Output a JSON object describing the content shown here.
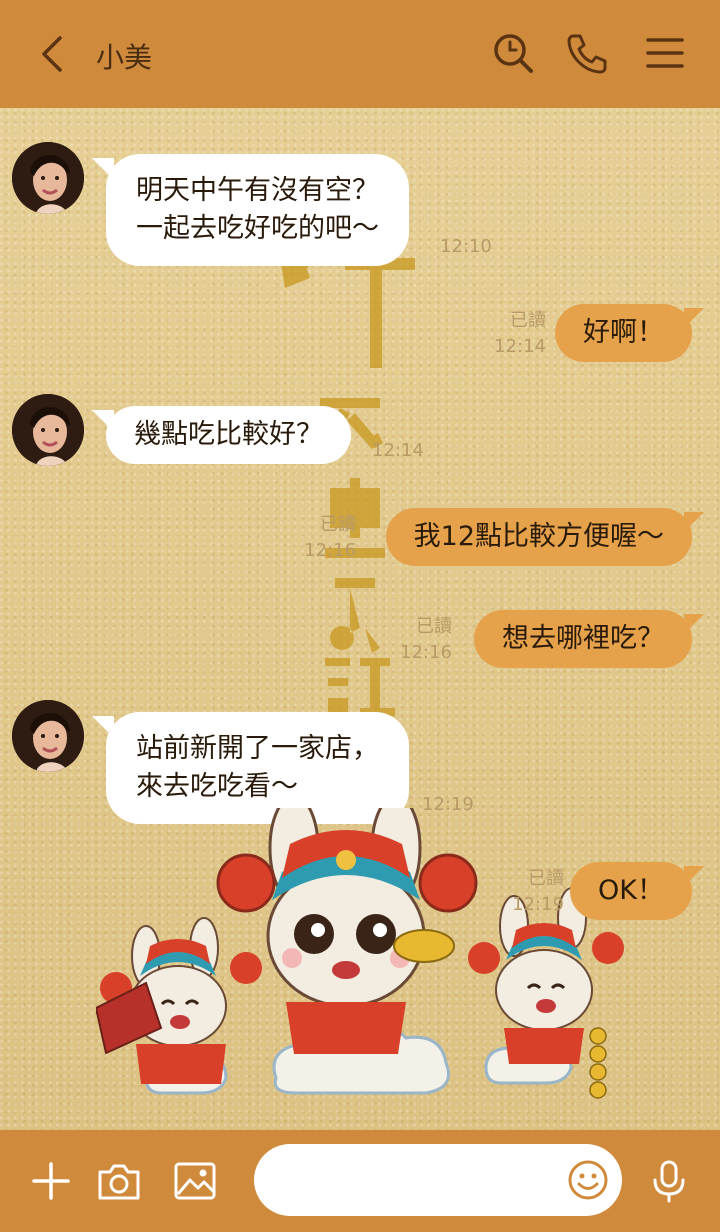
{
  "header": {
    "back_icon": "chevron-left-icon",
    "contact_name": "小美",
    "icons": [
      "search-icon",
      "phone-icon",
      "menu-icon"
    ]
  },
  "messages": [
    {
      "side": "in",
      "lines": [
        "明天中午有沒有空？",
        "一起去吃好吃的吧～"
      ],
      "time": "12:10"
    },
    {
      "side": "out",
      "text": "好啊！",
      "read": "已讀",
      "time": "12:14"
    },
    {
      "side": "in",
      "text": "幾點吃比較好？",
      "time": "12:14"
    },
    {
      "side": "out",
      "text": "我12點比較方便喔～",
      "read": "已讀",
      "time": "12:16"
    },
    {
      "side": "out",
      "text": "想去哪裡吃？",
      "read": "已讀",
      "time": "12:16"
    },
    {
      "side": "in",
      "lines": [
        "站前新開了一家店，",
        "來去吃吃看～"
      ],
      "time": "12:19"
    },
    {
      "side": "out",
      "text": "OK！",
      "read": "已讀",
      "time": "12:19"
    }
  ],
  "input": {
    "placeholder": ""
  },
  "footer": {
    "icons": [
      "plus-icon",
      "camera-icon",
      "image-icon",
      "emoji-icon",
      "microphone-icon"
    ]
  },
  "colors": {
    "bar": "#d08a3c",
    "outgoing_bubble": "#e6a24b",
    "background": "#e2c98e",
    "icon": "#5a3412"
  }
}
